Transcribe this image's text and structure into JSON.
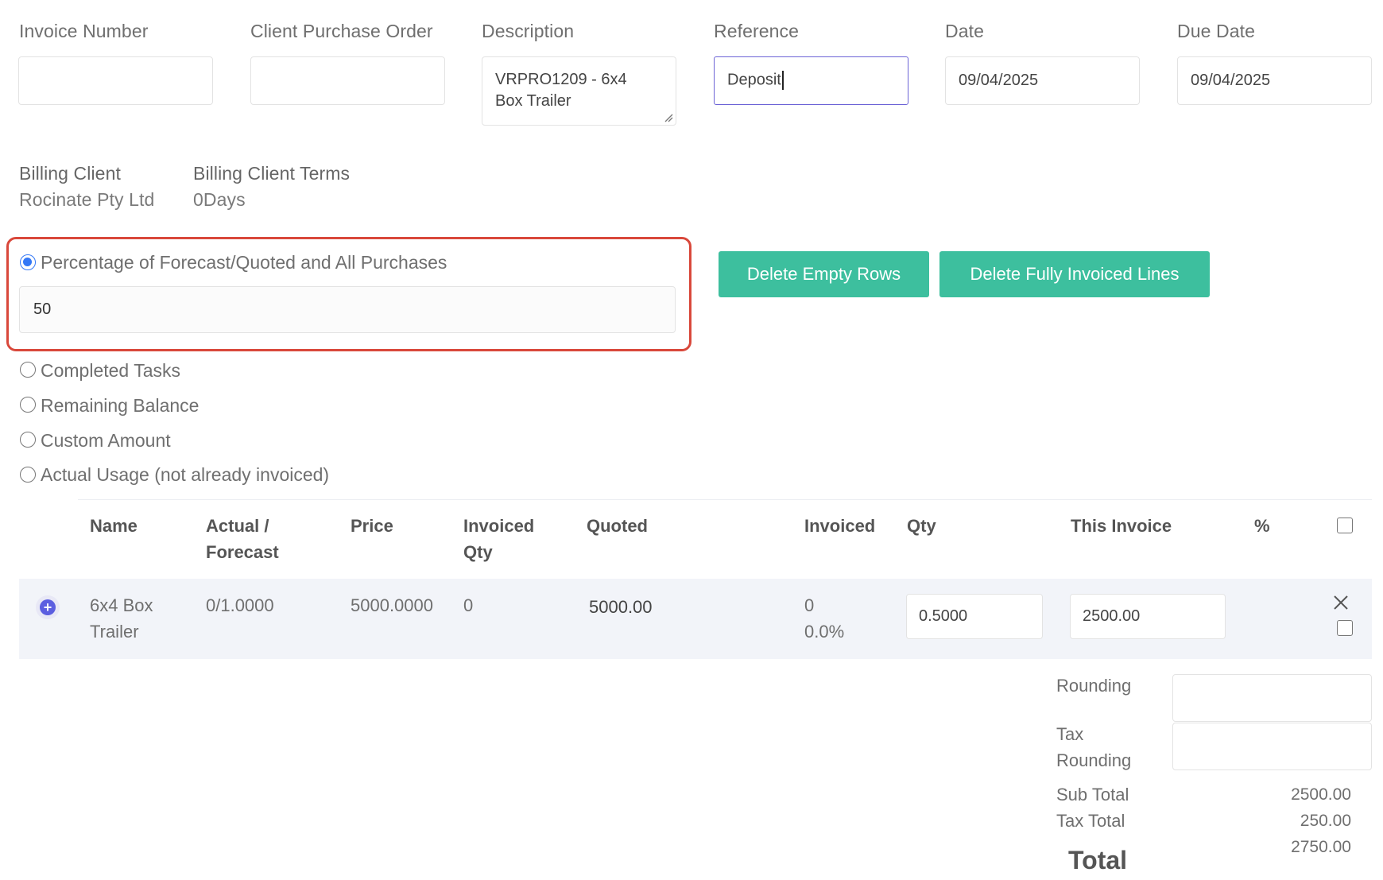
{
  "header_fields": {
    "invoice_number": {
      "label": "Invoice Number",
      "value": ""
    },
    "client_po": {
      "label": "Client Purchase Order",
      "value": ""
    },
    "description": {
      "label": "Description",
      "line1": "VRPRO1209 - 6x4",
      "line2": "Box Trailer"
    },
    "reference": {
      "label": "Reference",
      "value": "Deposit"
    },
    "date": {
      "label": "Date",
      "value": "09/04/2025"
    },
    "due_date": {
      "label": "Due Date",
      "value": "09/04/2025"
    }
  },
  "billing": {
    "client_label": "Billing Client",
    "client_value": "Rocinate Pty Ltd",
    "terms_label": "Billing Client Terms",
    "terms_value": "0Days"
  },
  "invoice_modes": {
    "selected": "percentage",
    "percentage_label": "Percentage of Forecast/Quoted and All Purchases",
    "percentage_value": "50",
    "completed_tasks": "Completed Tasks",
    "remaining_balance": "Remaining Balance",
    "custom_amount": "Custom Amount",
    "actual_usage": "Actual Usage (not already invoiced)"
  },
  "actions": {
    "delete_empty_rows": "Delete Empty Rows",
    "delete_fully_invoiced": "Delete Fully Invoiced Lines"
  },
  "table": {
    "headers": {
      "name": "Name",
      "actual_forecast_1": "Actual /",
      "actual_forecast_2": "Forecast",
      "price": "Price",
      "invoiced_qty_1": "Invoiced",
      "invoiced_qty_2": "Qty",
      "quoted": "Quoted",
      "invoiced": "Invoiced",
      "qty": "Qty",
      "this_invoice": "This Invoice",
      "percent": "%"
    },
    "rows": [
      {
        "name_line1": "6x4 Box",
        "name_line2": "Trailer",
        "actual_forecast": "0/1.0000",
        "price": "5000.0000",
        "invoiced_qty": "0",
        "quoted": "5000.00",
        "invoiced_amount": "0",
        "invoiced_percent": "0.0%",
        "qty": "0.5000",
        "this_invoice": "2500.00"
      }
    ]
  },
  "totals": {
    "rounding_label": "Rounding",
    "rounding_value": "",
    "tax_rounding_label_1": "Tax",
    "tax_rounding_label_2": "Rounding",
    "tax_rounding_value": "",
    "sub_total_label": "Sub Total",
    "sub_total_value": "2500.00",
    "tax_total_label": "Tax Total",
    "tax_total_value": "250.00",
    "total_label": "Total",
    "total_value": "2750.00"
  },
  "colors": {
    "accent_button": "#3dbf9e",
    "radio_selected": "#3478f6",
    "highlight_frame": "#d9483b",
    "focus_border": "#6c63d6",
    "row_background": "#f2f4f9"
  },
  "icons": {
    "row_expand": "plus-circle-icon",
    "row_remove": "close-icon"
  }
}
